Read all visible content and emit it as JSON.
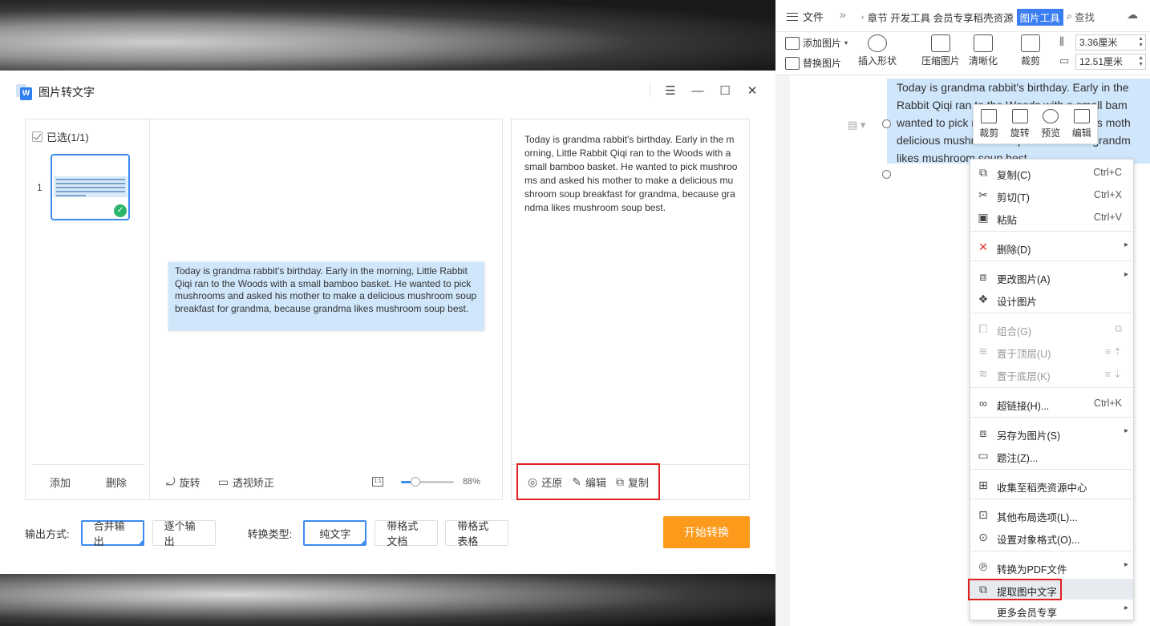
{
  "dialog": {
    "title": "图片转文字",
    "select_all": "已选(1/1)",
    "thumb_index": "1",
    "thumb_add": "添加",
    "thumb_delete": "删除",
    "preview_text": "Today is grandma rabbit's birthday. Early in the morning, Little Rabbit Qiqi ran to the Woods with a small bamboo basket. He wanted to pick mushrooms and asked his mother to make a delicious mushroom soup breakfast for grandma, because grandma likes mushroom soup best.",
    "rotate": "旋转",
    "perspective": "透视矫正",
    "zoom": "88%",
    "zoom_fraction": 0.88,
    "result_text": "Today is grandma rabbit's birthday. Early in the morning, Little Rabbit Qiqi ran to the Woods with a small bamboo basket. He wanted to pick mushrooms and asked his mother to make a delicious mushroom soup breakfast for grandma, because grandma likes mushroom soup best.",
    "restore": "还原",
    "edit": "编辑",
    "copy": "复制",
    "output_label": "输出方式:",
    "output_merge": "合并输出",
    "output_each": "逐个输出",
    "type_label": "转换类型:",
    "type_plain": "纯文字",
    "type_doc": "带格式文档",
    "type_table": "带格式表格",
    "start": "开始转换",
    "accent_color": "#3d8bf0",
    "start_color": "#fb9a1b"
  },
  "wps": {
    "file_menu": "文件",
    "tabs_text": "章节 开发工具 会员专享稻壳资源",
    "active_tab": "图片工具",
    "search": "查找",
    "add_image": "添加图片",
    "replace_image": "替换图片",
    "insert_shape": "插入形状",
    "compress": "压缩图片",
    "clarify": "清晰化",
    "crop": "裁剪",
    "height": "3.36厘米",
    "width": "12.51厘米",
    "doc_lines": [
      "Today is grandma rabbit's birthday. Early in the",
      "Rabbit Qiqi ran to the Woods with a small bam",
      "wanted to pick mushrooms and asked his moth",
      "delicious mushroom soup breakfast for grandm",
      "likes mushroom soup best."
    ],
    "float_crop": "裁剪",
    "float_rotate": "旋转",
    "float_preview": "预览",
    "float_edit": "编辑"
  },
  "context_menu": {
    "items": [
      {
        "label": "复制(C)",
        "shortcut": "Ctrl+C"
      },
      {
        "label": "剪切(T)",
        "shortcut": "Ctrl+X"
      },
      {
        "label": "粘贴",
        "shortcut": "Ctrl+V"
      },
      {
        "label": "删除(D)"
      },
      {
        "label": "更改图片(A)"
      },
      {
        "label": "设计图片"
      },
      {
        "label": "组合(G)"
      },
      {
        "label": "置于顶层(U)"
      },
      {
        "label": "置于底层(K)"
      },
      {
        "label": "超链接(H)...",
        "shortcut": "Ctrl+K"
      },
      {
        "label": "另存为图片(S)"
      },
      {
        "label": "题注(Z)..."
      },
      {
        "label": "收集至稻壳资源中心"
      },
      {
        "label": "其他布局选项(L)..."
      },
      {
        "label": "设置对象格式(O)..."
      },
      {
        "label": "转换为PDF文件"
      },
      {
        "label": "提取图中文字"
      },
      {
        "label": "更多会员专享"
      }
    ]
  }
}
